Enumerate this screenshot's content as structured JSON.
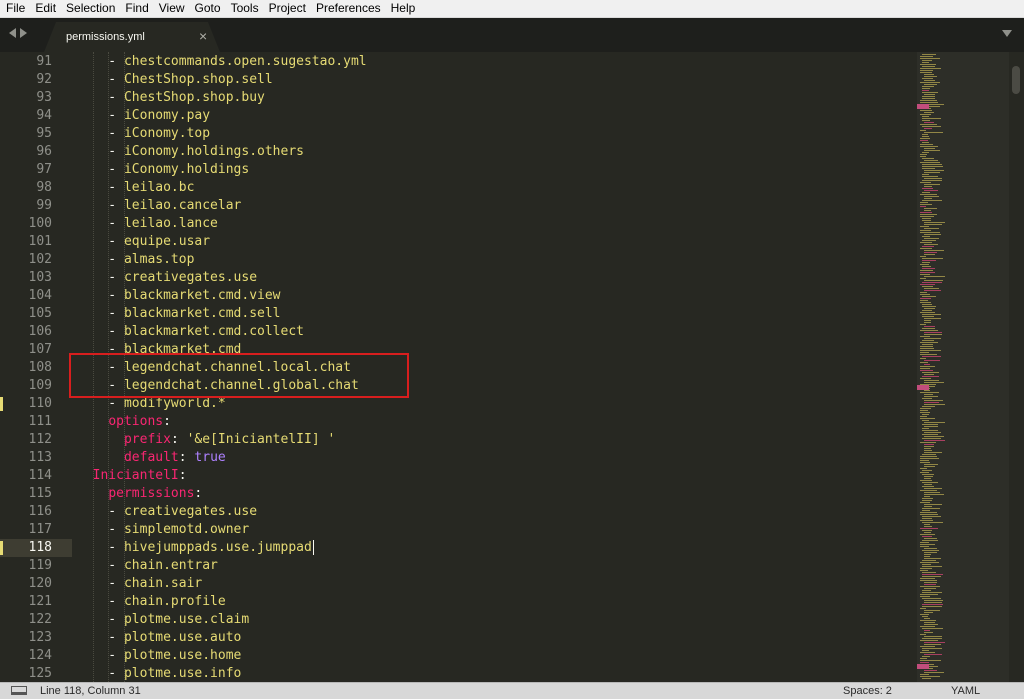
{
  "menu": [
    "File",
    "Edit",
    "Selection",
    "Find",
    "View",
    "Goto",
    "Tools",
    "Project",
    "Preferences",
    "Help"
  ],
  "tab": {
    "filename": "permissions.yml",
    "close": "×"
  },
  "editor": {
    "current_line": 118,
    "modified_lines": [
      110,
      118
    ],
    "lines": [
      {
        "n": "91",
        "tokens": [
          [
            "ind",
            "    - "
          ],
          [
            "plain",
            "chestcommands.open.sugestao.yml"
          ]
        ]
      },
      {
        "n": "92",
        "tokens": [
          [
            "ind",
            "    - "
          ],
          [
            "plain",
            "ChestShop.shop.sell"
          ]
        ]
      },
      {
        "n": "93",
        "tokens": [
          [
            "ind",
            "    - "
          ],
          [
            "plain",
            "ChestShop.shop.buy"
          ]
        ]
      },
      {
        "n": "94",
        "tokens": [
          [
            "ind",
            "    - "
          ],
          [
            "plain",
            "iConomy.pay"
          ]
        ]
      },
      {
        "n": "95",
        "tokens": [
          [
            "ind",
            "    - "
          ],
          [
            "plain",
            "iConomy.top"
          ]
        ]
      },
      {
        "n": "96",
        "tokens": [
          [
            "ind",
            "    - "
          ],
          [
            "plain",
            "iConomy.holdings.others"
          ]
        ]
      },
      {
        "n": "97",
        "tokens": [
          [
            "ind",
            "    - "
          ],
          [
            "plain",
            "iConomy.holdings"
          ]
        ]
      },
      {
        "n": "98",
        "tokens": [
          [
            "ind",
            "    - "
          ],
          [
            "plain",
            "leilao.bc"
          ]
        ]
      },
      {
        "n": "99",
        "tokens": [
          [
            "ind",
            "    - "
          ],
          [
            "plain",
            "leilao.cancelar"
          ]
        ]
      },
      {
        "n": "100",
        "tokens": [
          [
            "ind",
            "    - "
          ],
          [
            "plain",
            "leilao.lance"
          ]
        ]
      },
      {
        "n": "101",
        "tokens": [
          [
            "ind",
            "    - "
          ],
          [
            "plain",
            "equipe.usar"
          ]
        ]
      },
      {
        "n": "102",
        "tokens": [
          [
            "ind",
            "    - "
          ],
          [
            "plain",
            "almas.top"
          ]
        ]
      },
      {
        "n": "103",
        "tokens": [
          [
            "ind",
            "    - "
          ],
          [
            "plain",
            "creativegates.use"
          ]
        ]
      },
      {
        "n": "104",
        "tokens": [
          [
            "ind",
            "    - "
          ],
          [
            "plain",
            "blackmarket.cmd.view"
          ]
        ]
      },
      {
        "n": "105",
        "tokens": [
          [
            "ind",
            "    - "
          ],
          [
            "plain",
            "blackmarket.cmd.sell"
          ]
        ]
      },
      {
        "n": "106",
        "tokens": [
          [
            "ind",
            "    - "
          ],
          [
            "plain",
            "blackmarket.cmd.collect"
          ]
        ]
      },
      {
        "n": "107",
        "tokens": [
          [
            "ind",
            "    - "
          ],
          [
            "plain",
            "blackmarket.cmd"
          ]
        ]
      },
      {
        "n": "108",
        "tokens": [
          [
            "ind",
            "    - "
          ],
          [
            "plain",
            "legendchat.channel.local.chat"
          ]
        ]
      },
      {
        "n": "109",
        "tokens": [
          [
            "ind",
            "    - "
          ],
          [
            "plain",
            "legendchat.channel.global.chat"
          ]
        ]
      },
      {
        "n": "110",
        "tokens": [
          [
            "ind",
            "    - "
          ],
          [
            "plain",
            "modifyworld.*"
          ]
        ]
      },
      {
        "n": "111",
        "tokens": [
          [
            "ind",
            "    "
          ],
          [
            "key",
            "options"
          ],
          [
            "colon",
            ":"
          ]
        ]
      },
      {
        "n": "112",
        "tokens": [
          [
            "ind",
            "      "
          ],
          [
            "key",
            "prefix"
          ],
          [
            "colon",
            ": "
          ],
          [
            "plain",
            "'&e[IniciantelII] '"
          ]
        ]
      },
      {
        "n": "113",
        "tokens": [
          [
            "ind",
            "      "
          ],
          [
            "key",
            "default"
          ],
          [
            "colon",
            ": "
          ],
          [
            "bool",
            "true"
          ]
        ]
      },
      {
        "n": "114",
        "tokens": [
          [
            "ind",
            "  "
          ],
          [
            "key",
            "IniciantelI"
          ],
          [
            "colon",
            ":"
          ]
        ]
      },
      {
        "n": "115",
        "tokens": [
          [
            "ind",
            "    "
          ],
          [
            "key",
            "permissions"
          ],
          [
            "colon",
            ":"
          ]
        ]
      },
      {
        "n": "116",
        "tokens": [
          [
            "ind",
            "    - "
          ],
          [
            "plain",
            "creativegates.use"
          ]
        ]
      },
      {
        "n": "117",
        "tokens": [
          [
            "ind",
            "    - "
          ],
          [
            "plain",
            "simplemotd.owner"
          ]
        ]
      },
      {
        "n": "118",
        "tokens": [
          [
            "ind",
            "    - "
          ],
          [
            "plain",
            "hivejumppads.use.jumppad"
          ]
        ]
      },
      {
        "n": "119",
        "tokens": [
          [
            "ind",
            "    - "
          ],
          [
            "plain",
            "chain.entrar"
          ]
        ]
      },
      {
        "n": "120",
        "tokens": [
          [
            "ind",
            "    - "
          ],
          [
            "plain",
            "chain.sair"
          ]
        ]
      },
      {
        "n": "121",
        "tokens": [
          [
            "ind",
            "    - "
          ],
          [
            "plain",
            "chain.profile"
          ]
        ]
      },
      {
        "n": "122",
        "tokens": [
          [
            "ind",
            "    - "
          ],
          [
            "plain",
            "plotme.use.claim"
          ]
        ]
      },
      {
        "n": "123",
        "tokens": [
          [
            "ind",
            "    - "
          ],
          [
            "plain",
            "plotme.use.auto"
          ]
        ]
      },
      {
        "n": "124",
        "tokens": [
          [
            "ind",
            "    - "
          ],
          [
            "plain",
            "plotme.use.home"
          ]
        ]
      },
      {
        "n": "125",
        "tokens": [
          [
            "ind",
            "    - "
          ],
          [
            "plain",
            "plotme.use.info"
          ]
        ]
      }
    ]
  },
  "status": {
    "position": "Line 118, Column 31",
    "spaces": "Spaces: 2",
    "syntax": "YAML"
  },
  "colors": {
    "background": "#272822",
    "string": "#e6db74",
    "key": "#f92672",
    "boolean": "#ae81ff",
    "highlight_box": "#d81e1e"
  }
}
